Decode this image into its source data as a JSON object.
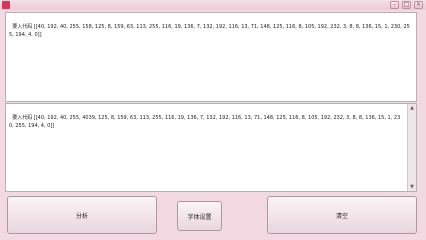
{
  "window": {
    "title": "",
    "minimize": "–",
    "maximize": "□",
    "close": "×"
  },
  "top_box": {
    "text": "要入代码 [[40, 192, 40, 255, 158, 125, 8, 159, 63, 113, 255, 116, 19, 136, 7, 132, 192, 116, 13, 71, 148, 125, 116, 8, 105, 192, 232, 3, 8, 8, 136, 15, 1, 230, 255, 194, 4, 0]]"
  },
  "bottom_box": {
    "text": "要入代码 [[40, 192, 40, 255, 4039, 125, 8, 159, 63, 113, 255, 116, 19, 136, 7, 132, 192, 116, 13, 71, 148, 125, 116, 8, 105, 192, 232, 3, 8, 8, 136, 15, 1, 230, 255, 194, 4, 0]]"
  },
  "buttons": {
    "analyze": "分析",
    "font": "字体设置",
    "clear": "清空"
  }
}
